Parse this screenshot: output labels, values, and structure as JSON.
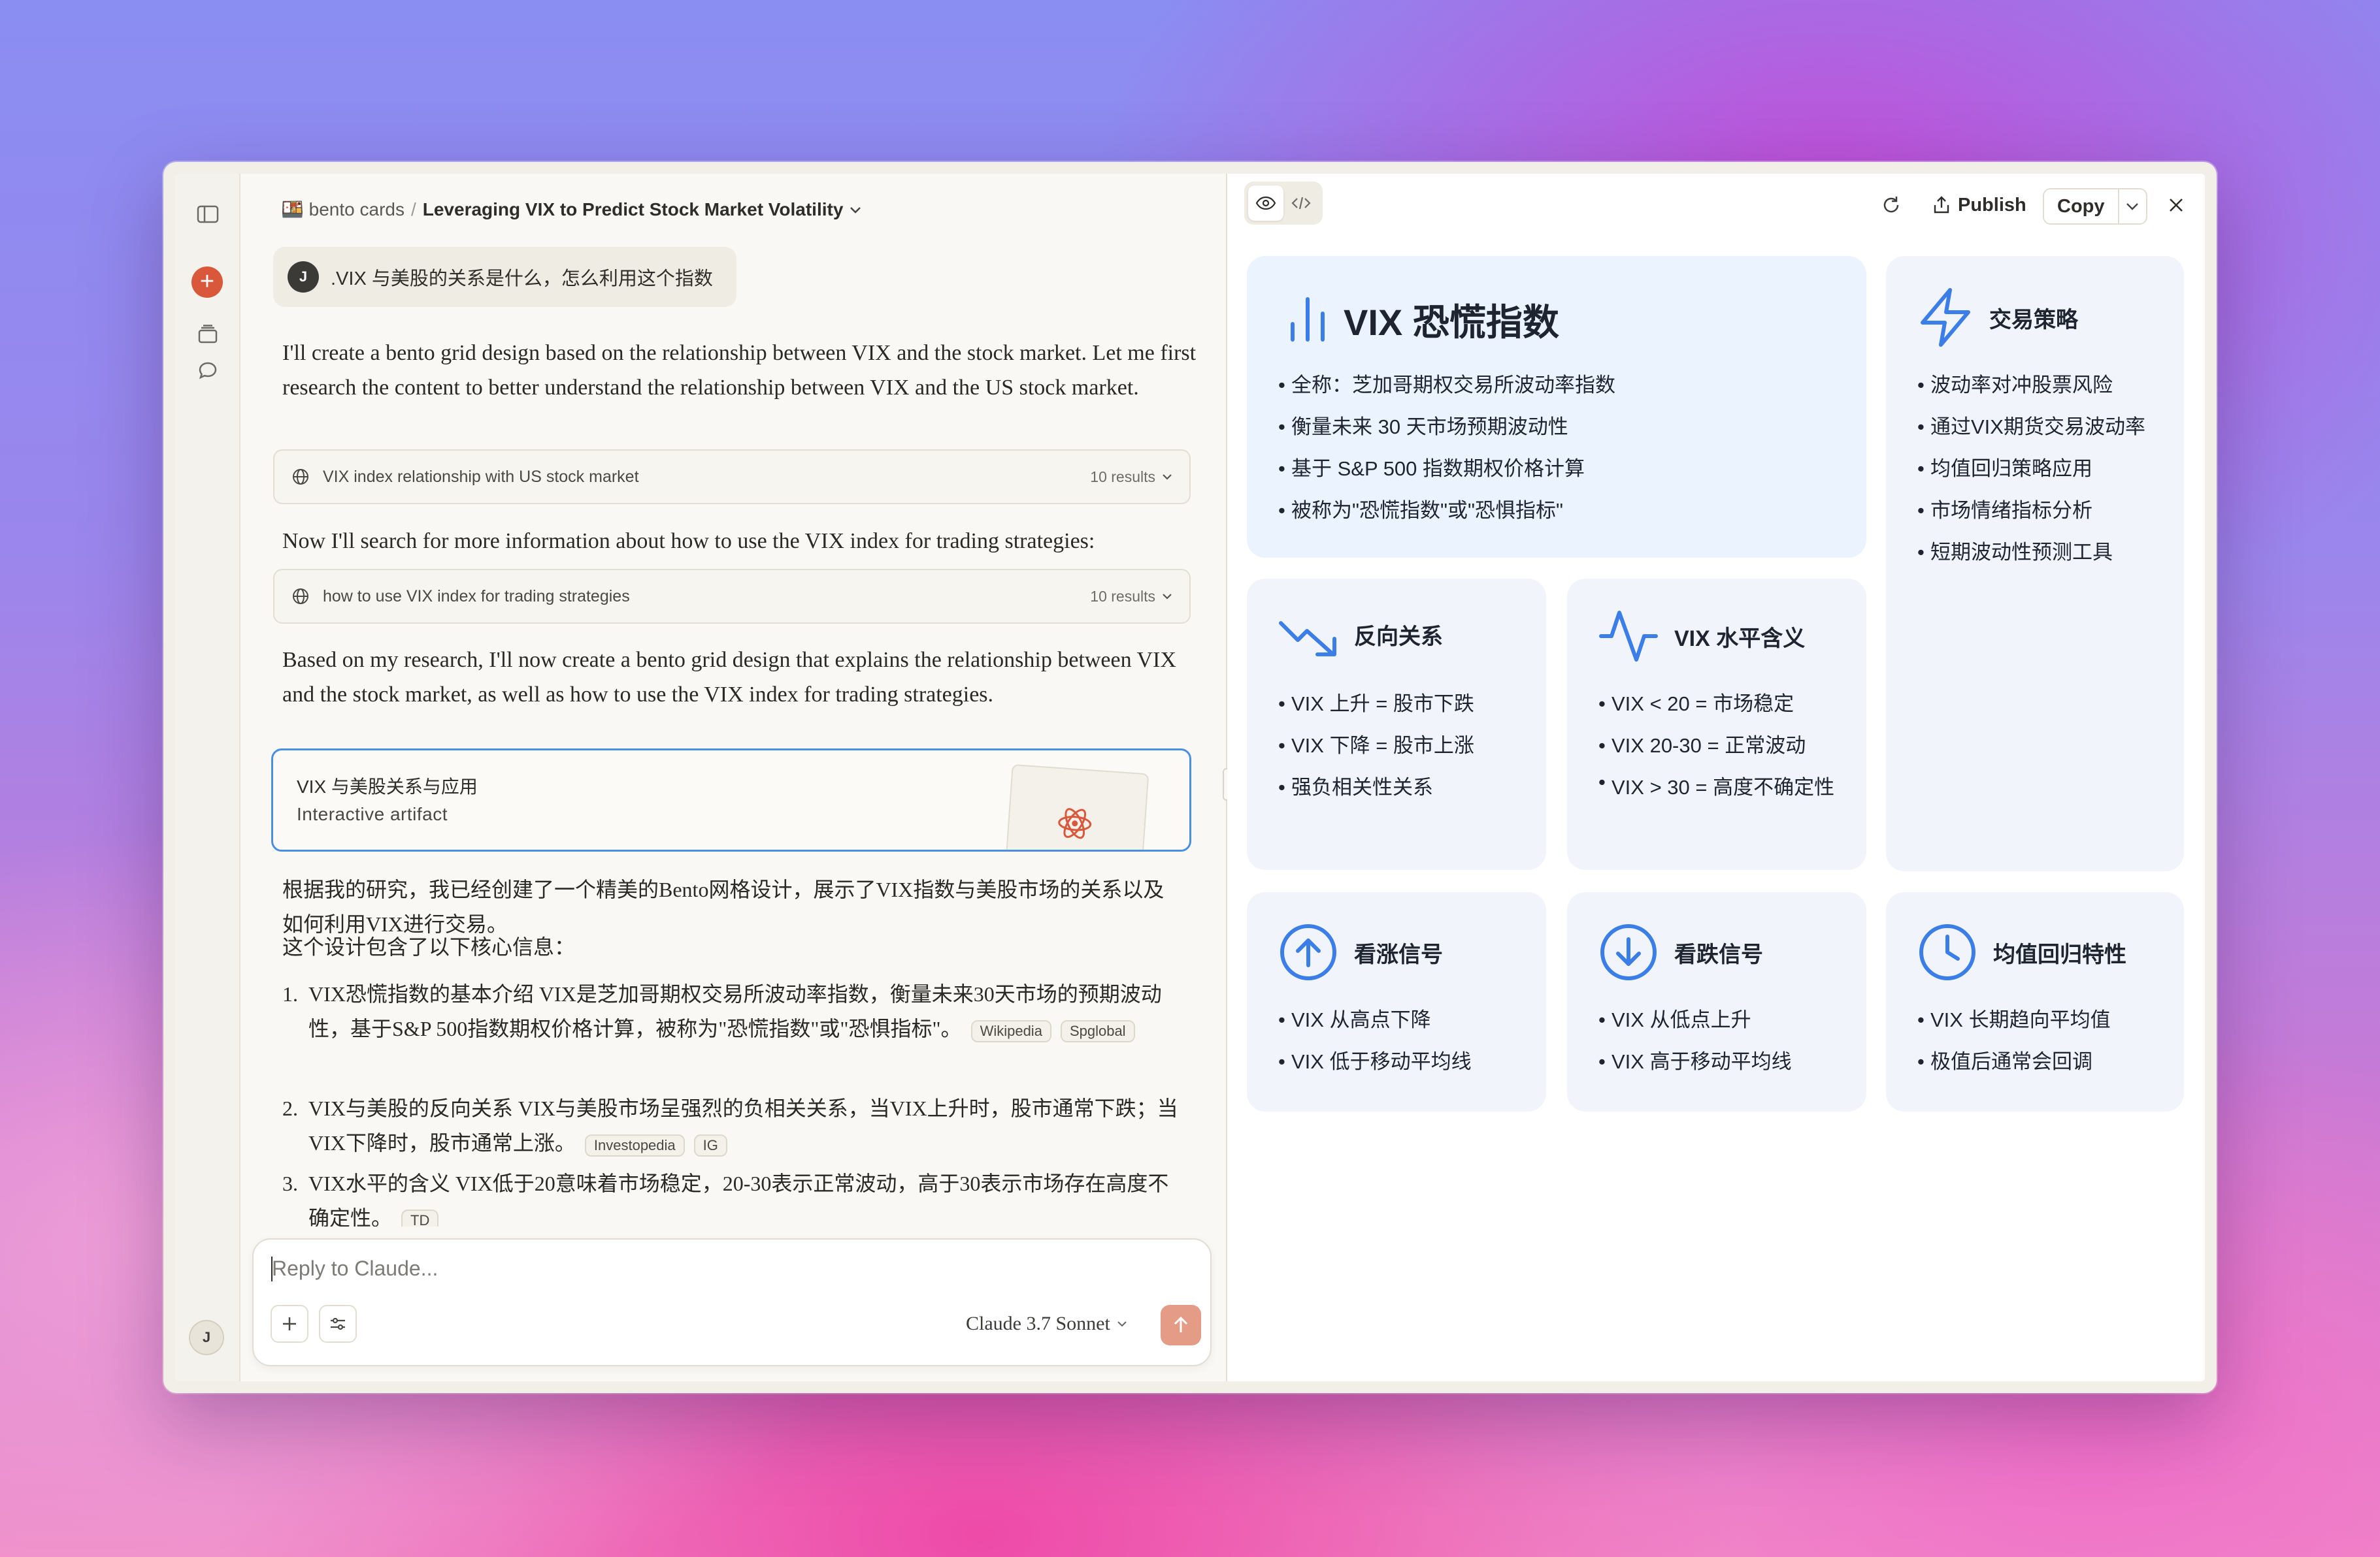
{
  "breadcrumb": {
    "project": "🍱 bento cards",
    "separator": "/",
    "title": "Leveraging VIX to Predict Stock Market Volatility"
  },
  "user": {
    "initial": "J",
    "message": ".VIX 与美股的关系是什么，怎么利用这个指数"
  },
  "messages": {
    "p1": "I'll create a bento grid design based on the relationship between VIX and the stock market. Let me first research the content to better understand the relationship between VIX and the US stock market.",
    "search1": {
      "query": "VIX index relationship with US stock market",
      "count": "10 results"
    },
    "p2": "Now I'll search for more information about how to use the VIX index for trading strategies:",
    "search2": {
      "query": "how to use VIX index for trading strategies",
      "count": "10 results"
    },
    "p3": "Based on my research, I'll now create a bento grid design that explains the relationship between VIX and the stock market, as well as how to use the VIX index for trading strategies.",
    "artifact": {
      "title": "VIX 与美股关系与应用",
      "subtitle": "Interactive artifact"
    },
    "cn1": "根据我的研究，我已经创建了一个精美的Bento网格设计，展示了VIX指数与美股市场的关系以及如何利用VIX进行交易。",
    "cn2": "这个设计包含了以下核心信息：",
    "list": [
      {
        "n": "1.",
        "text": "VIX恐慌指数的基本介绍 VIX是芝加哥期权交易所波动率指数，衡量未来30天市场的预期波动性，基于S&P 500指数期权价格计算，被称为\"恐慌指数\"或\"恐惧指标\"。",
        "chips": [
          "Wikipedia",
          "Spglobal"
        ]
      },
      {
        "n": "2.",
        "text": "VIX与美股的反向关系 VIX与美股市场呈强烈的负相关关系，当VIX上升时，股市通常下跌；当VIX下降时，股市通常上涨。",
        "chips": [
          "Investopedia",
          "IG"
        ]
      },
      {
        "n": "3.",
        "text": "VIX水平的含义 VIX低于20意味着市场稳定，20-30表示正常波动，高于30表示市场存在高度不确定性。",
        "chips": [
          "TD"
        ]
      }
    ]
  },
  "composer": {
    "placeholder": "Reply to Claude...",
    "model": "Claude 3.7 Sonnet"
  },
  "toolbar": {
    "publish": "Publish",
    "copy": "Copy"
  },
  "bento": {
    "main": {
      "title": "VIX 恐慌指数",
      "icon": "bar-chart-icon",
      "items": [
        "全称：芝加哥期权交易所波动率指数",
        "衡量未来 30 天市场预期波动性",
        "基于 S&P 500 指数期权价格计算",
        "被称为\"恐慌指数\"或\"恐惧指标\""
      ]
    },
    "strategy": {
      "title": "交易策略",
      "icon": "lightning-icon",
      "items": [
        "波动率对冲股票风险",
        "通过VIX期货交易波动率",
        "均值回归策略应用",
        "市场情绪指标分析",
        "短期波动性预测工具"
      ]
    },
    "inverse": {
      "title": "反向关系",
      "icon": "trend-down-icon",
      "items": [
        "VIX 上升 = 股市下跌",
        "VIX 下降 = 股市上涨",
        "强负相关性关系"
      ]
    },
    "levels": {
      "title": "VIX 水平含义",
      "icon": "activity-icon",
      "items": [
        "VIX < 20 = 市场稳定",
        "VIX 20-30 = 正常波动",
        "VIX > 30 = 高度不确定性"
      ]
    },
    "bull": {
      "title": "看涨信号",
      "icon": "arrow-up-circle-icon",
      "items": [
        "VIX 从高点下降",
        "VIX 低于移动平均线"
      ]
    },
    "bear": {
      "title": "看跌信号",
      "icon": "arrow-down-circle-icon",
      "items": [
        "VIX 从低点上升",
        "VIX 高于移动平均线"
      ]
    },
    "mean": {
      "title": "均值回归特性",
      "icon": "clock-icon",
      "items": [
        "VIX 长期趋向平均值",
        "极值后通常会回调"
      ]
    }
  },
  "colors": {
    "accent": "#3b7ee8",
    "brand": "#d9583b",
    "send": "#e59c86",
    "tile": "#f1f5fb",
    "tile_main": "#ebf3fe"
  }
}
